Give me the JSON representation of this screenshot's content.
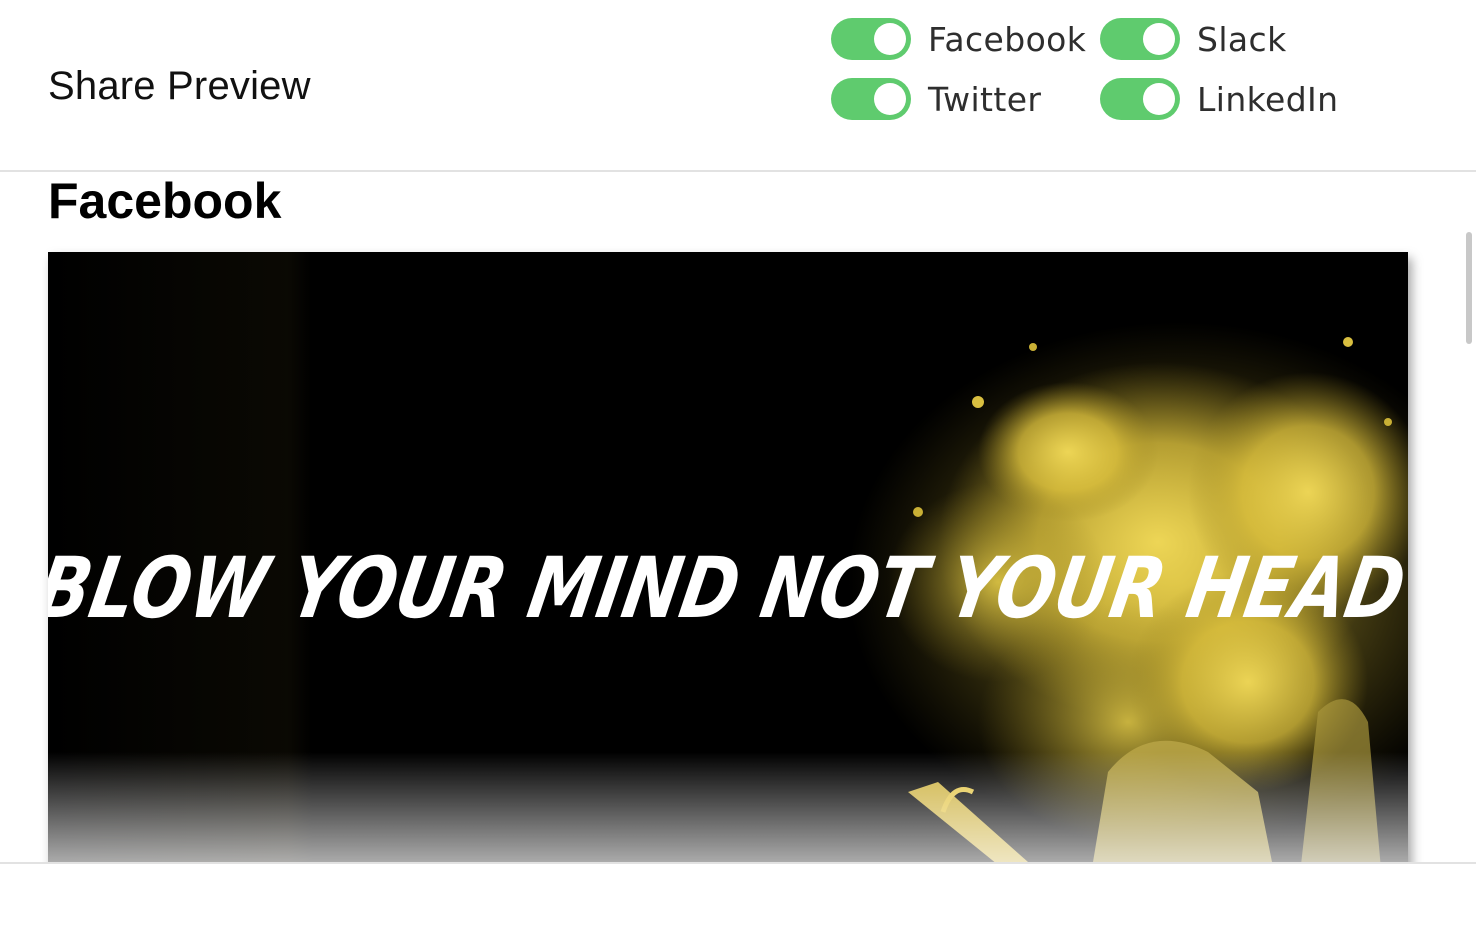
{
  "header": {
    "title": "Share Preview",
    "toggles": [
      {
        "label": "Facebook",
        "on": true
      },
      {
        "label": "Slack",
        "on": true
      },
      {
        "label": "Twitter",
        "on": true
      },
      {
        "label": "LinkedIn",
        "on": true
      }
    ]
  },
  "preview": {
    "heading": "Facebook",
    "image_text": "BLOW YOUR MIND NOT YOUR HEAD"
  },
  "colors": {
    "toggle_on": "#5fcb6e",
    "image_background": "#000000",
    "smoke_yellow": "#e8cf45"
  }
}
